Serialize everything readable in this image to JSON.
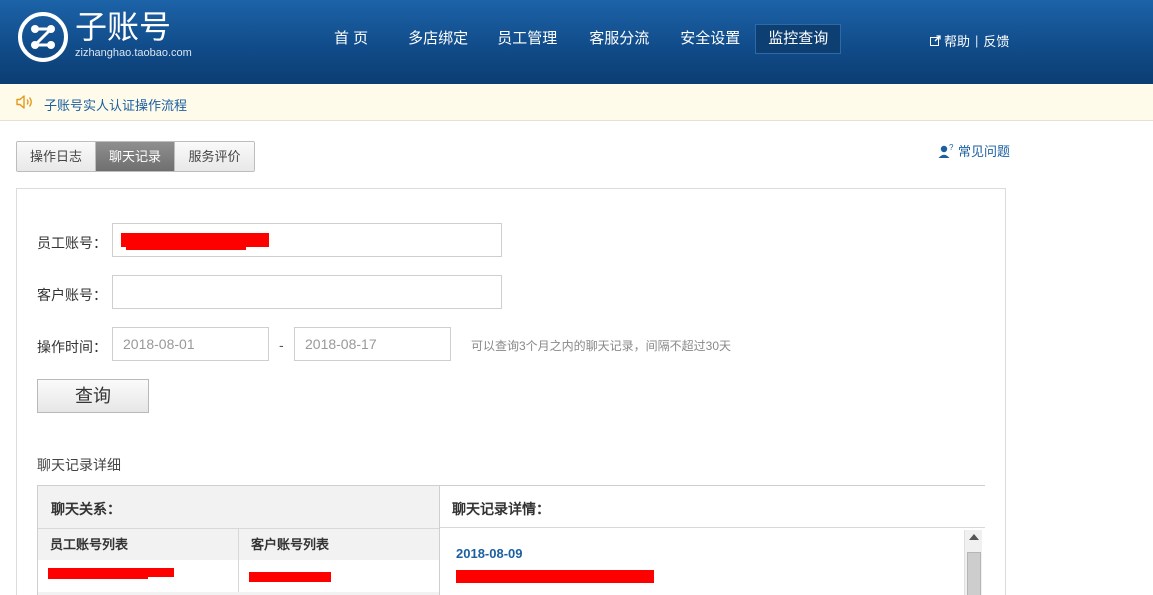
{
  "header": {
    "logo_title": "子账号",
    "logo_subtitle": "zizhanghao.taobao.com",
    "nav": [
      {
        "label": "首 页",
        "active": false
      },
      {
        "label": "多店绑定",
        "active": false
      },
      {
        "label": "员工管理",
        "active": false
      },
      {
        "label": "客服分流",
        "active": false
      },
      {
        "label": "安全设置",
        "active": false
      },
      {
        "label": "监控查询",
        "active": true
      }
    ],
    "help_label": "帮助",
    "feedback_label": "反馈"
  },
  "notice": {
    "text": "子账号实人认证操作流程"
  },
  "tabs": [
    {
      "label": "操作日志",
      "active": false
    },
    {
      "label": "聊天记录",
      "active": true
    },
    {
      "label": "服务评价",
      "active": false
    }
  ],
  "faq_label": "常见问题",
  "form": {
    "employee_label": "员工账号：",
    "customer_label": "客户账号：",
    "time_label": "操作时间：",
    "start_date": "2018-08-01",
    "end_date": "2018-08-17",
    "range_separator": "-",
    "hint": "可以查询3个月之内的聊天记录，间隔不超过30天",
    "query_button": "查询"
  },
  "chat": {
    "section_title": "聊天记录详细",
    "relation_header": "聊天关系：",
    "employee_list_header": "员工账号列表",
    "customer_list_header": "客户账号列表",
    "detail_header": "聊天记录详情：",
    "detail_date": "2018-08-09"
  },
  "colors": {
    "header_blue": "#114c8a",
    "link_blue": "#1c5fa0",
    "redaction": "#ff0000",
    "notice_bg": "#fffbea"
  }
}
